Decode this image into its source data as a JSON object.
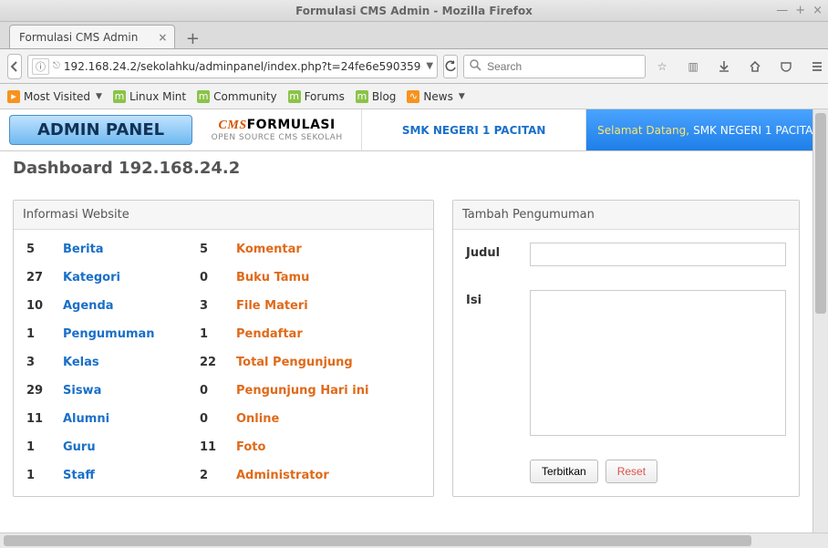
{
  "window": {
    "title": "Formulasi CMS Admin - Mozilla Firefox"
  },
  "tab": {
    "label": "Formulasi CMS Admin"
  },
  "urlbar": {
    "url": "192.168.24.2/sekolahku/adminpanel/index.php?t=24fe6e590359"
  },
  "search": {
    "placeholder": "Search"
  },
  "bookmarks": {
    "most_visited": "Most Visited",
    "linux_mint": "Linux Mint",
    "community": "Community",
    "forums": "Forums",
    "blog": "Blog",
    "news": "News"
  },
  "page": {
    "admin_panel": "ADMIN PANEL",
    "logo_cms": "CMS",
    "logo_formulasi": "FORMULASI",
    "logo_sub": "OPEN SOURCE CMS SEKOLAH",
    "school": "SMK NEGERI 1 PACITAN",
    "welcome_pre": "Selamat Datang,",
    "welcome_name": "SMK NEGERI 1 PACITA",
    "dashboard": "Dashboard 192.168.24.2",
    "info_title": "Informasi Website",
    "tambah_title": "Tambah Pengumuman",
    "judul_label": "Judul",
    "isi_label": "Isi",
    "publish": "Terbitkan",
    "reset": "Reset"
  },
  "info_left": [
    {
      "n": "5",
      "label": "Berita"
    },
    {
      "n": "27",
      "label": "Kategori"
    },
    {
      "n": "10",
      "label": "Agenda"
    },
    {
      "n": "1",
      "label": "Pengumuman"
    },
    {
      "n": "3",
      "label": "Kelas"
    },
    {
      "n": "29",
      "label": "Siswa"
    },
    {
      "n": "11",
      "label": "Alumni"
    },
    {
      "n": "1",
      "label": "Guru"
    },
    {
      "n": "1",
      "label": "Staff"
    }
  ],
  "info_right": [
    {
      "n": "5",
      "label": "Komentar"
    },
    {
      "n": "0",
      "label": "Buku Tamu"
    },
    {
      "n": "3",
      "label": "File Materi"
    },
    {
      "n": "1",
      "label": "Pendaftar"
    },
    {
      "n": "22",
      "label": "Total Pengunjung"
    },
    {
      "n": "0",
      "label": "Pengunjung Hari ini"
    },
    {
      "n": "0",
      "label": "Online"
    },
    {
      "n": "11",
      "label": "Foto"
    },
    {
      "n": "2",
      "label": "Administrator"
    }
  ]
}
